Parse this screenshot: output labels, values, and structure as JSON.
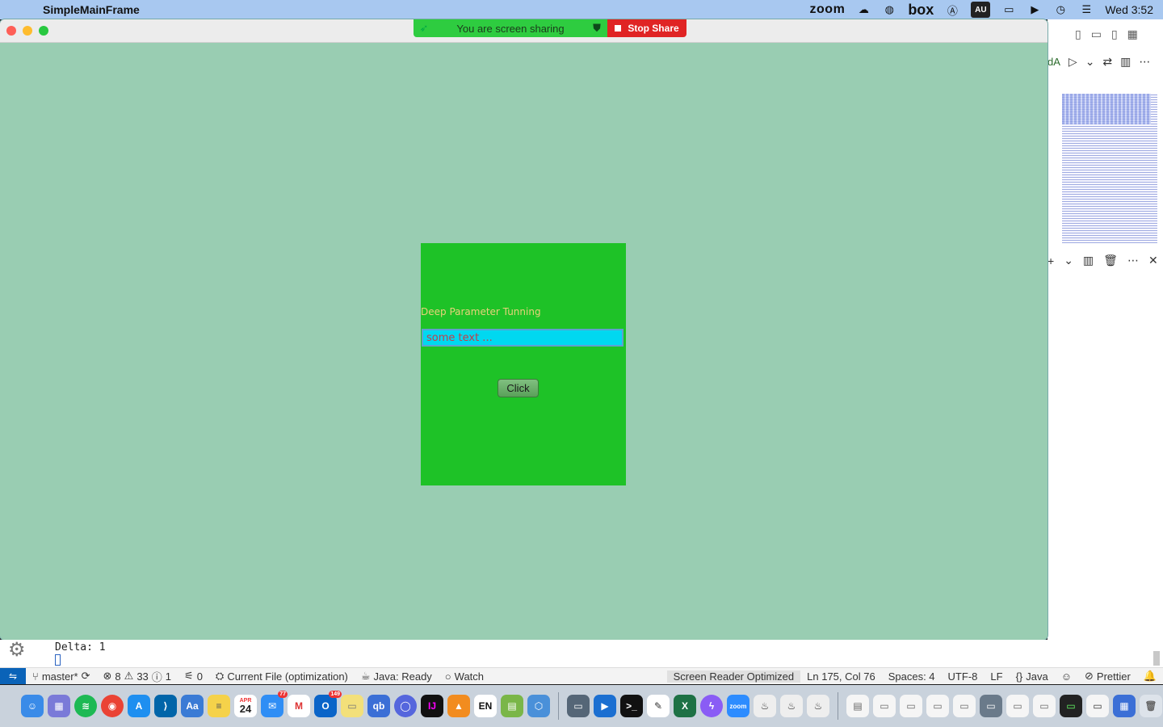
{
  "menubar": {
    "app_name": "SimpleMainFrame",
    "zoom_label": "zoom",
    "box_label": "box",
    "au_label": "AU",
    "clock": "Wed 3:52"
  },
  "share_banner": {
    "message": "You are screen sharing",
    "stop_label": "Stop Share"
  },
  "java_frame": {
    "panel_title": "Deep Parameter Tunning",
    "input_placeholder": "some text ...",
    "button_label": "Click",
    "colors": {
      "window_bg": "#99cdb2",
      "panel_bg": "#1ec227",
      "input_bg": "#00d8f0"
    }
  },
  "terminal": {
    "output": "Delta: 1"
  },
  "vscode": {
    "tab_fragment": "dA"
  },
  "statusbar": {
    "branch": "master*",
    "errors": "8",
    "warnings": "33",
    "info": "1",
    "ports": "0",
    "run_config": "Current File (optimization)",
    "java_status": "Java: Ready",
    "watch": "Watch",
    "screen_reader": "Screen Reader Optimized",
    "position": "Ln 175, Col 76",
    "spaces": "Spaces: 4",
    "encoding": "UTF-8",
    "eol": "LF",
    "language": "Java",
    "formatter": "Prettier"
  },
  "dock": {
    "calendar_month": "APR",
    "calendar_day": "24",
    "mail_badge": "77",
    "outlook_badge": "149",
    "qb_label": "qb",
    "en_label": "EN",
    "ij_label": "IJ"
  }
}
